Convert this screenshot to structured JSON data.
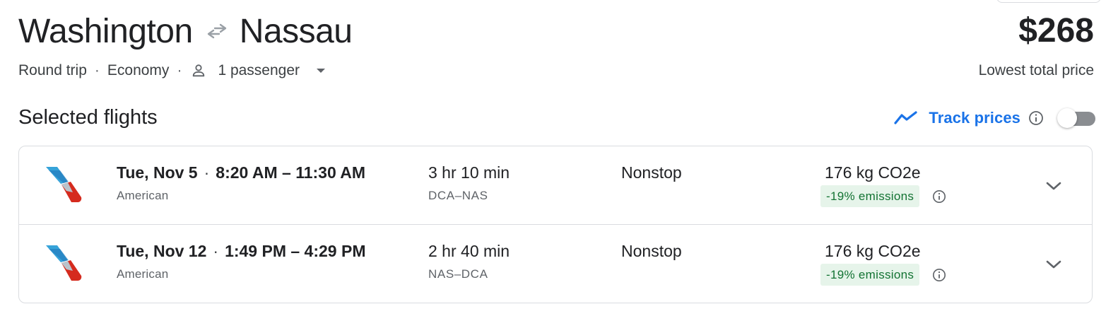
{
  "header": {
    "origin": "Washington",
    "destination": "Nassau",
    "swap_icon": "swap-arrows-icon",
    "trip_type": "Round trip",
    "cabin_class": "Economy",
    "passengers": "1 passenger",
    "separator": "·"
  },
  "price": {
    "amount": "$268",
    "label": "Lowest total price"
  },
  "selected": {
    "title": "Selected flights",
    "track_label": "Track prices",
    "track_enabled": false
  },
  "flights": [
    {
      "date": "Tue, Nov 5",
      "time_range": "8:20 AM – 11:30 AM",
      "airline": "American",
      "duration": "3 hr 10 min",
      "airports": "DCA–NAS",
      "stops": "Nonstop",
      "emissions": "176 kg CO2e",
      "emission_badge": "-19% emissions"
    },
    {
      "date": "Tue, Nov 12",
      "time_range": "1:49 PM – 4:29 PM",
      "airline": "American",
      "duration": "2 hr 40 min",
      "airports": "NAS–DCA",
      "stops": "Nonstop",
      "emissions": "176 kg CO2e",
      "emission_badge": "-19% emissions"
    }
  ],
  "colors": {
    "accent": "#1a73e8",
    "text_primary": "#202124",
    "text_secondary": "#5f6368",
    "badge_bg": "#e6f4ea",
    "badge_text": "#137333",
    "border": "#dadce0",
    "toggle_off": "#8a8d91"
  }
}
